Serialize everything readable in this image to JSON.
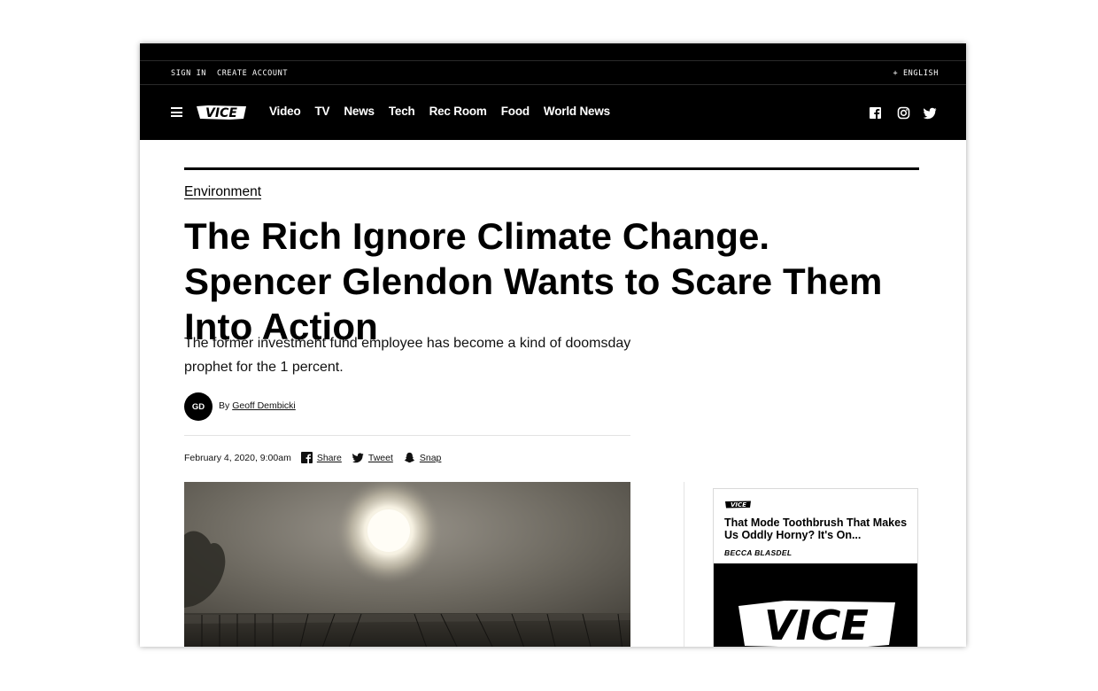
{
  "utility": {
    "sign_in": "SIGN IN",
    "create_account": "CREATE ACCOUNT",
    "language": "+ ENGLISH"
  },
  "nav": {
    "logo": "VICE",
    "items": [
      {
        "label": "Video"
      },
      {
        "label": "TV"
      },
      {
        "label": "News"
      },
      {
        "label": "Tech"
      },
      {
        "label": "Rec Room"
      },
      {
        "label": "Food"
      },
      {
        "label": "World News"
      }
    ],
    "social_icons": [
      "facebook-icon",
      "instagram-icon",
      "twitter-icon"
    ]
  },
  "article": {
    "category": "Environment",
    "headline": "The Rich Ignore Climate Change. Spencer Glendon Wants to Scare Them Into Action",
    "dek": "The former investment fund employee has become a kind of doomsday prophet for the 1 percent.",
    "author_initials": "GD",
    "byline_prefix": "By",
    "author": "Geoff Dembicki",
    "date": "February 4, 2020, 9:00am",
    "share_label": "Share",
    "tweet_label": "Tweet",
    "snap_label": "Snap"
  },
  "promo": {
    "logo": "VICE",
    "title": "That Mode Toothbrush That Makes Us Oddly Horny? It's On...",
    "author": "BECCA BLASDEL",
    "image_logo": "VICE"
  },
  "colors": {
    "nav_bg": "#000000",
    "text": "#000000",
    "background": "#ffffff"
  }
}
